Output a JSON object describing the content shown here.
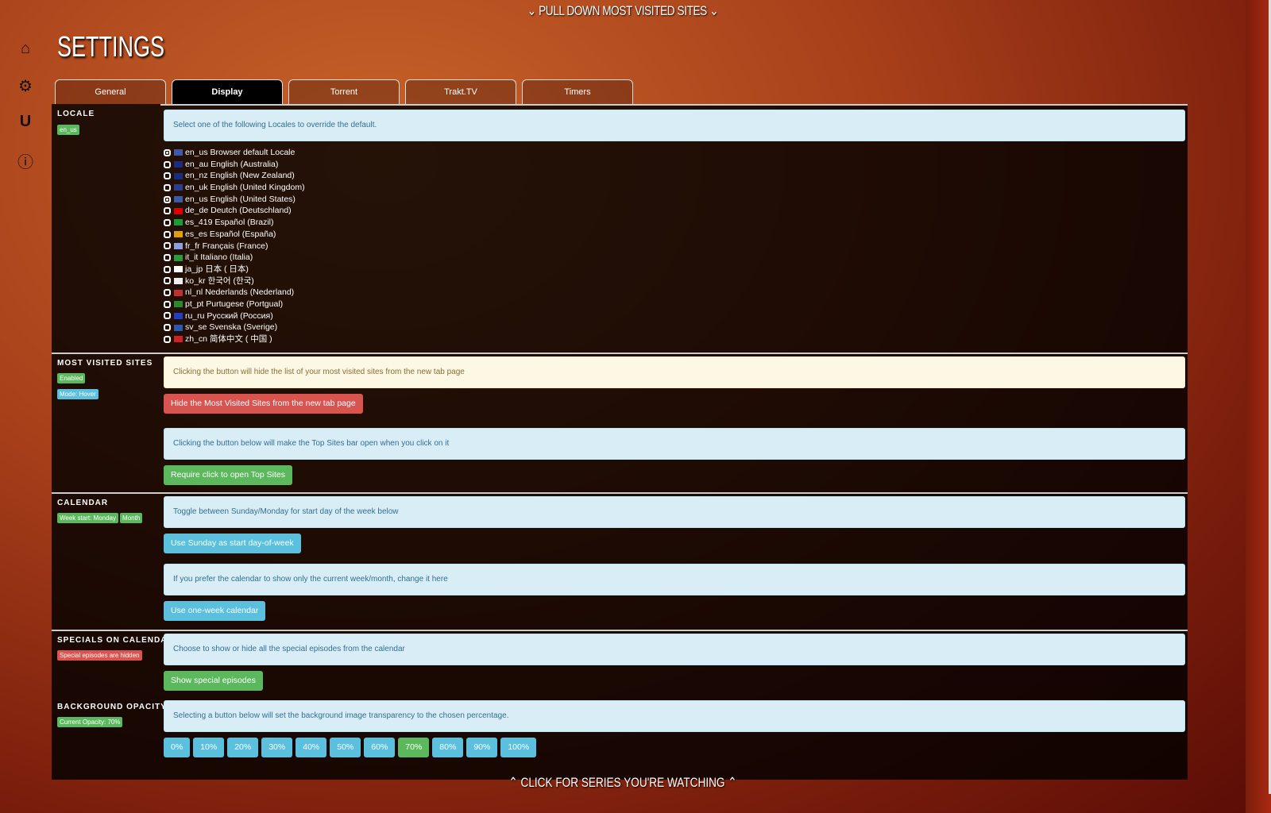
{
  "header": {
    "pull_down": "PULL DOWN MOST VISITED SITES",
    "bottom": "CLICK FOR SERIES YOU'RE WATCHING",
    "title": "SETTINGS"
  },
  "sidebar": [
    {
      "icon": "home-icon"
    },
    {
      "icon": "gear-icon"
    },
    {
      "icon": "magnet-icon"
    },
    {
      "icon": "info-icon"
    }
  ],
  "tabs": [
    "General",
    "Display",
    "Torrent",
    "Trakt.TV",
    "Timers"
  ],
  "active_tab": "Display",
  "locale": {
    "label": "LOCALE",
    "badge": "en_us",
    "info": "Select one of the following Locales to override the default.",
    "options": [
      {
        "text": "en_us Browser default Locale",
        "checked": true,
        "flag": "#3c5aa6"
      },
      {
        "text": "en_au English (Australia)",
        "checked": false,
        "flag": "#1a2c80"
      },
      {
        "text": "en_nz English (New Zealand)",
        "checked": false,
        "flag": "#1a2c80"
      },
      {
        "text": "en_uk English (United Kingdom)",
        "checked": false,
        "flag": "#2a3d8f"
      },
      {
        "text": "en_us English (United States)",
        "checked": true,
        "flag": "#3c5aa6"
      },
      {
        "text": "de_de Deutch (Deutschland)",
        "checked": false,
        "flag": "#d00"
      },
      {
        "text": "es_419 Español (Brazil)",
        "checked": false,
        "flag": "#1a9a3a"
      },
      {
        "text": "es_es Español (España)",
        "checked": false,
        "flag": "#e0a000"
      },
      {
        "text": "fr_fr Français (France)",
        "checked": false,
        "flag": "#8aa0e0"
      },
      {
        "text": "it_it Italiano (Italia)",
        "checked": false,
        "flag": "#2a9a3a"
      },
      {
        "text": "ja_jp 日本 ( 日本)",
        "checked": false,
        "flag": "#fff"
      },
      {
        "text": "ko_kr 한국어 (한국)",
        "checked": false,
        "flag": "#eee"
      },
      {
        "text": "nl_nl Nederlands (Nederland)",
        "checked": false,
        "flag": "#c03030"
      },
      {
        "text": "pt_pt Purtugese (Portgual)",
        "checked": false,
        "flag": "#2a8a2a"
      },
      {
        "text": "ru_ru Русский (Россия)",
        "checked": false,
        "flag": "#2040c0"
      },
      {
        "text": "sv_se Svenska (Sverige)",
        "checked": false,
        "flag": "#2a5ab0"
      },
      {
        "text": "zh_cn 简体中文 ( 中国 )",
        "checked": false,
        "flag": "#d02020"
      }
    ]
  },
  "most_visited": {
    "label": "MOST VISITED SITES",
    "badges": [
      "Enabled",
      "Mode: Hover"
    ],
    "warn": "Clicking the button will hide the list of your most visited sites from the new tab page",
    "hide_btn": "Hide the Most Visited Sites from the new tab page",
    "info2": "Clicking the button below will make the Top Sites bar open when you click on it",
    "require_btn": "Require click to open Top Sites"
  },
  "calendar": {
    "label": "CALENDAR",
    "badges": [
      "Week start: Monday",
      "Month"
    ],
    "info1": "Toggle between Sunday/Monday for start day of the week below",
    "sunday_btn": "Use Sunday as start day-of-week",
    "info2": "If you prefer the calendar to show only the current week/month, change it here",
    "week_btn": "Use one-week calendar"
  },
  "specials": {
    "label": "SPECIALS ON CALENDAR",
    "badge": "Special episodes are hidden",
    "info": "Choose to show or hide all the special episodes from the calendar",
    "btn": "Show special episodes"
  },
  "opacity": {
    "label": "BACKGROUND OPACITY",
    "badge": "Current Opacity: 70%",
    "info": "Selecting a button below will set the background image transparency to the chosen percentage.",
    "options": [
      "0%",
      "10%",
      "20%",
      "30%",
      "40%",
      "50%",
      "60%",
      "70%",
      "80%",
      "90%",
      "100%"
    ],
    "selected": "70%"
  }
}
